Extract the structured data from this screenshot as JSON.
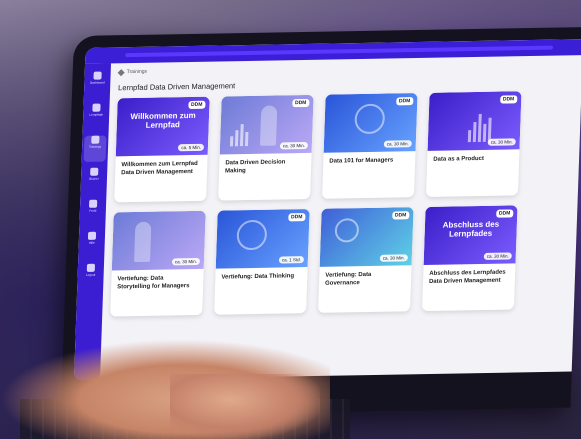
{
  "breadcrumb": {
    "label": "Trainings"
  },
  "page_title": "Lernpfad Data Driven Management",
  "sidebar": {
    "items": [
      {
        "label": "Dashboard",
        "active": false
      },
      {
        "label": "Lernpfade",
        "active": false
      },
      {
        "label": "Trainings",
        "active": true
      },
      {
        "label": "Bücher",
        "active": false
      },
      {
        "label": "Profil",
        "active": false
      },
      {
        "label": "Hilfe",
        "active": false
      },
      {
        "label": "Logout",
        "active": false
      }
    ]
  },
  "cards": [
    {
      "title": "Willkommen zum Lernpfad Data Driven Management",
      "thumb_title": "Willkommen zum Lernpfad",
      "badge": "DDM",
      "duration": "ca. 5 Min."
    },
    {
      "title": "Data Driven Decision Making",
      "thumb_title": "",
      "badge": "DDM",
      "duration": "ca. 30 Min."
    },
    {
      "title": "Data 101 for Managers",
      "thumb_title": "",
      "badge": "DDM",
      "duration": "ca. 30 Min."
    },
    {
      "title": "Data as a Product",
      "thumb_title": "",
      "badge": "DDM",
      "duration": "ca. 30 Min."
    },
    {
      "title": "Vertiefung: Data Storytelling for Managers",
      "thumb_title": "",
      "badge": "",
      "duration": "ca. 30 Min."
    },
    {
      "title": "Vertiefung: Data Thinking",
      "thumb_title": "",
      "badge": "DDM",
      "duration": "ca. 1 Std."
    },
    {
      "title": "Vertiefung: Data Governance",
      "thumb_title": "",
      "badge": "DDM",
      "duration": "ca. 30 Min."
    },
    {
      "title": "Abschluss des Lernpfades Data Driven Management",
      "thumb_title": "Abschluss des Lernpfades",
      "badge": "DDM",
      "duration": "ca. 30 Min."
    }
  ]
}
